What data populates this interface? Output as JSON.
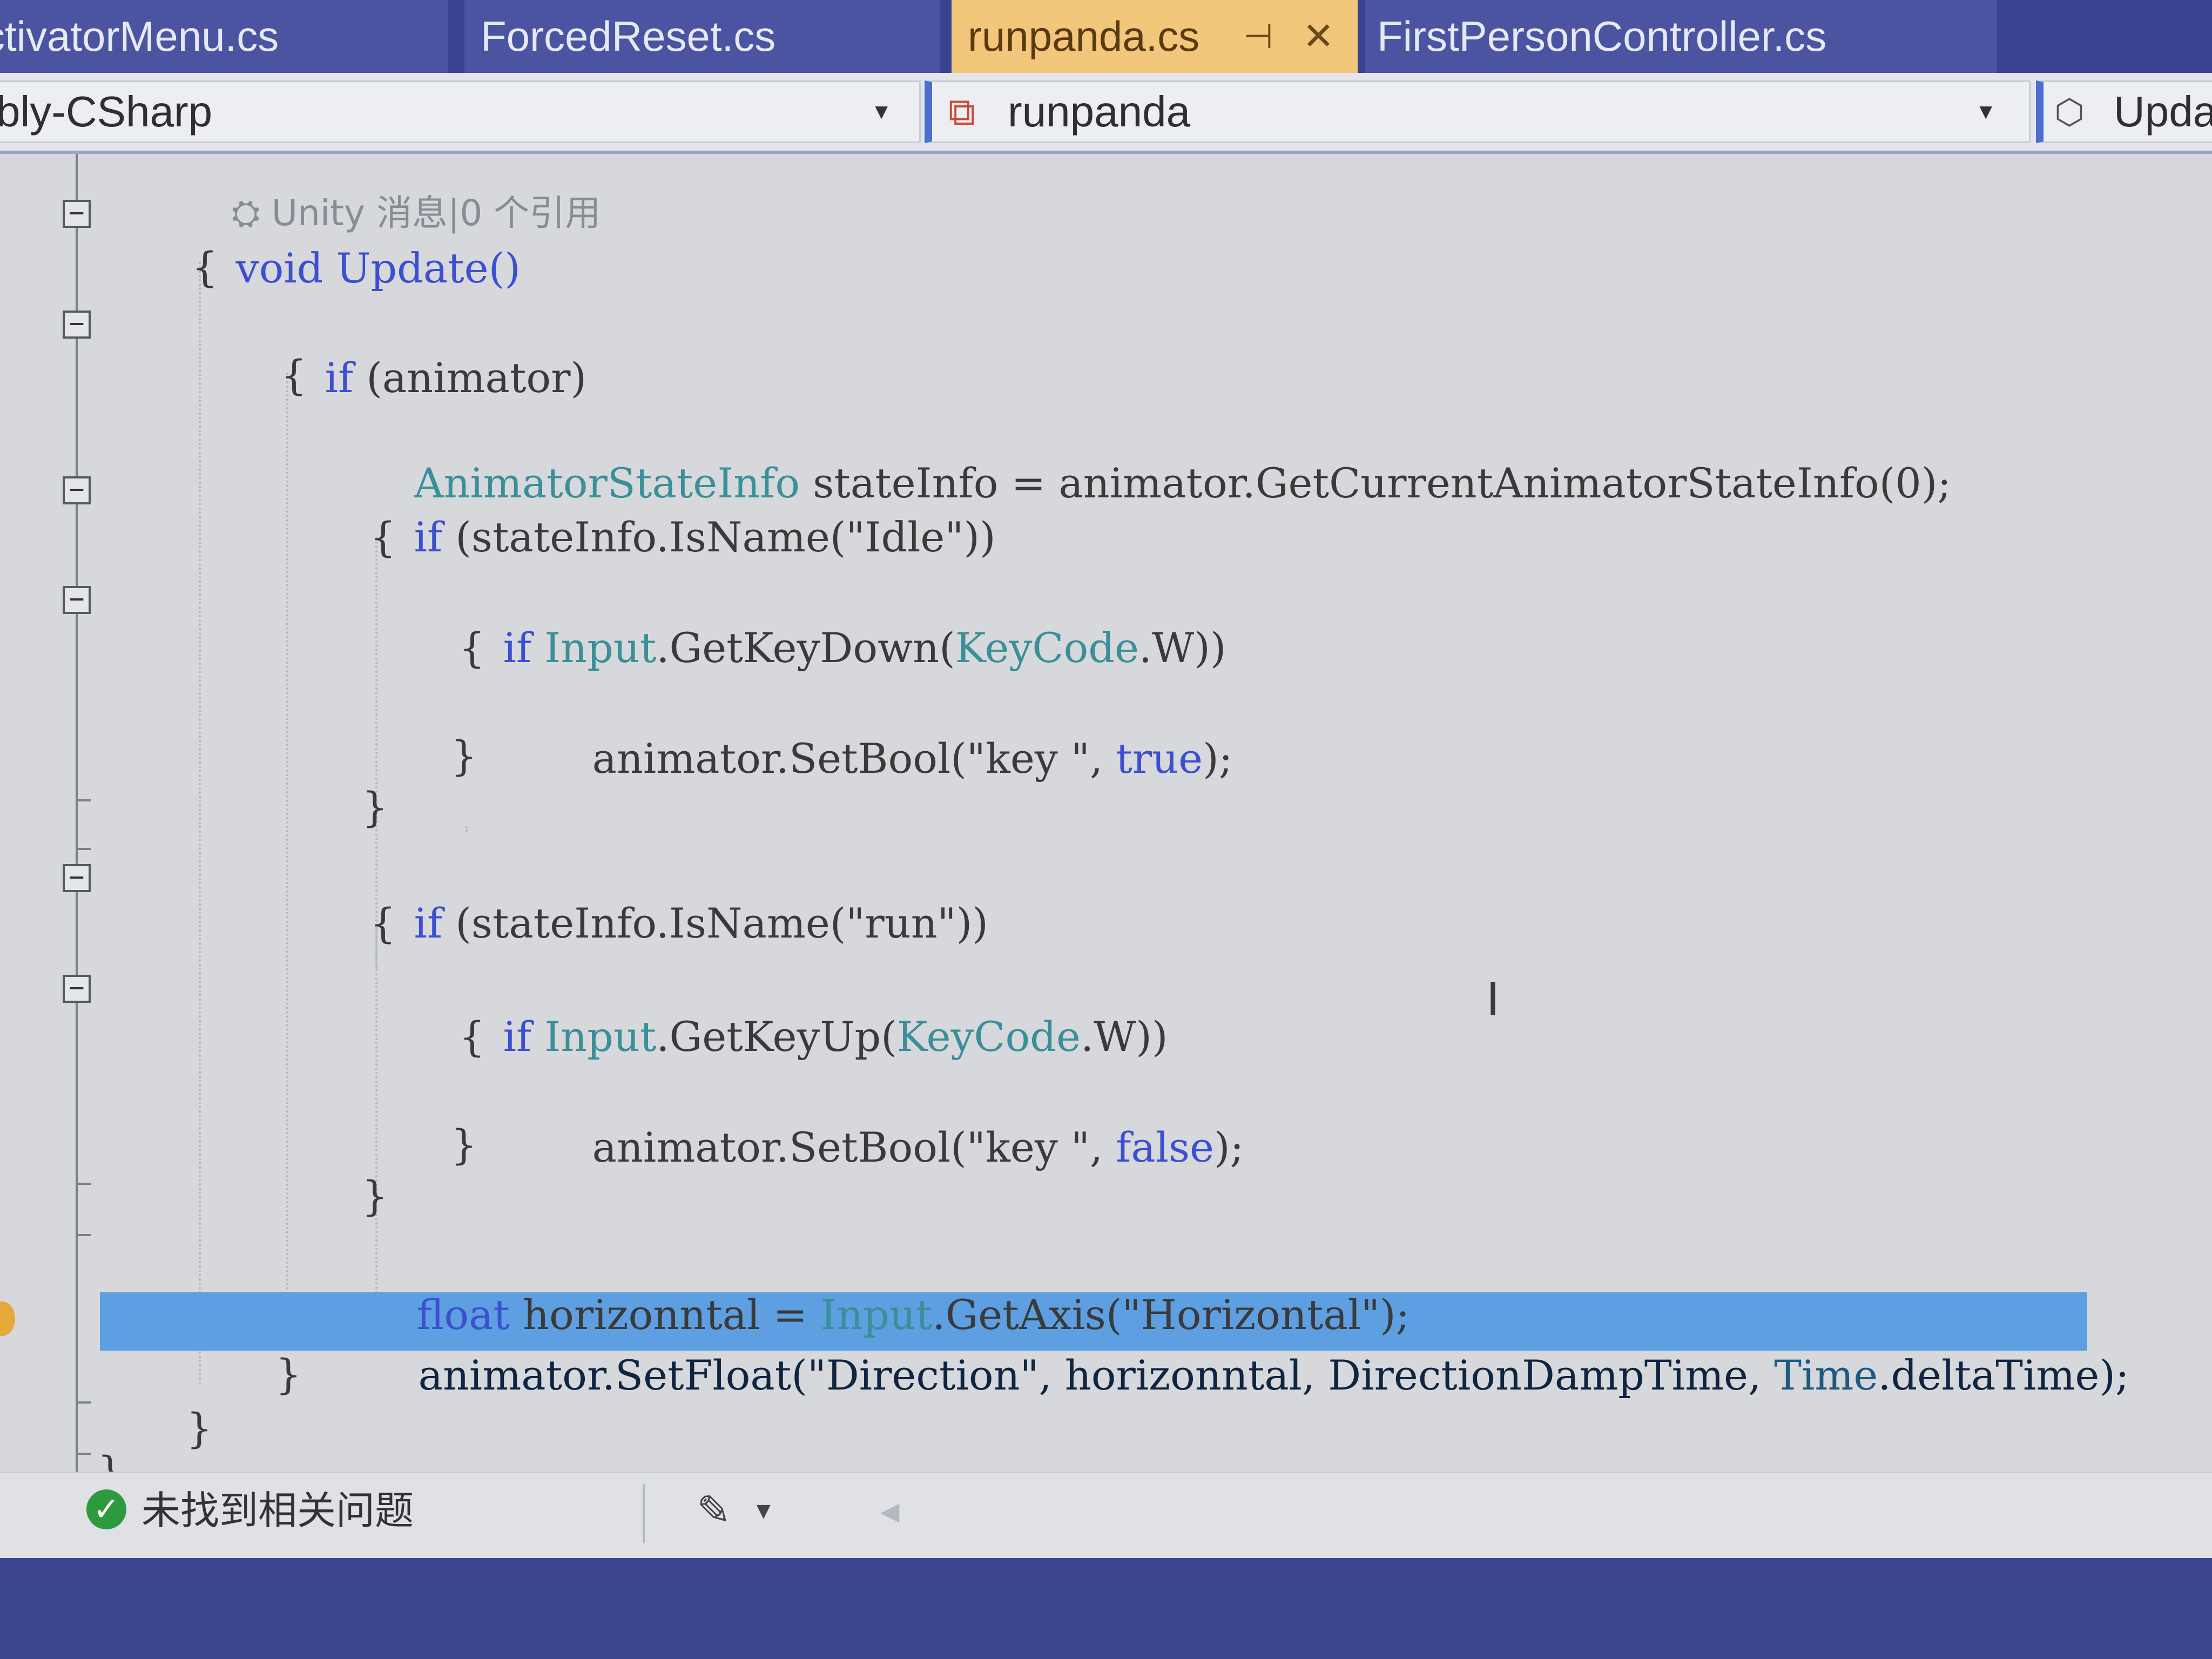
{
  "tabs": [
    {
      "label": "ctivatorMenu.cs"
    },
    {
      "label": "ForcedReset.cs"
    },
    {
      "label": "runpanda.cs",
      "active": true,
      "pin_glyph": "⊣",
      "close_glyph": "✕"
    },
    {
      "label": "FirstPersonController.cs"
    }
  ],
  "nav": {
    "project": "bly-CSharp",
    "class": "runpanda",
    "member": "Upda"
  },
  "code": {
    "codelens": "Unity 消息|0 个引用",
    "lines": {
      "l1_kw": "void",
      "l1_rest": " Update()",
      "l2": "{",
      "l3_kw": "if",
      "l3_rest": " (animator)",
      "l4": "{",
      "l5_type": "AnimatorStateInfo",
      "l5_rest": " stateInfo = animator.GetCurrentAnimatorStateInfo(0);",
      "l6_kw": "if",
      "l6_rest": " (stateInfo.IsName(\"Idle\"))",
      "l7": "{",
      "l8_kw": "if",
      "l8_type1": "Input",
      "l8_mid": ".GetKeyDown(",
      "l8_type2": "KeyCode",
      "l8_rest": ".W))",
      "l9": "{",
      "l10_pre": "animator.SetBool(\"key \", ",
      "l10_kw": "true",
      "l10_post": ");",
      "l11": "}",
      "l12": "}",
      "l13_kw": "if",
      "l13_rest": " (stateInfo.IsName(\"run\"))",
      "l14": "{",
      "l15_kw": "if",
      "l15_type1": "Input",
      "l15_mid": ".GetKeyUp(",
      "l15_type2": "KeyCode",
      "l15_rest": ".W))",
      "l16": "{",
      "l17_pre": "animator.SetBool(\"key \", ",
      "l17_kw": "false",
      "l17_post": ");",
      "l18": "}",
      "l19": "}",
      "l20_kw": "float",
      "l20_mid": " horizonntal = ",
      "l20_type": "Input",
      "l20_rest": ".GetAxis(\"Horizontal\");",
      "l21_pre": "animator.SetFloat(\"Direction\", horizonntal, DirectionDampTime, ",
      "l21_type": "Time",
      "l21_post": ".deltaTime);",
      "l22": "}",
      "l23": "}",
      "l24": "}"
    }
  },
  "status": {
    "message": "未找到相关问题"
  },
  "colors": {
    "tab_active": "#f2c77b",
    "tab_bar": "#39438f",
    "keyword": "#3c4fd0",
    "type": "#3a8f98",
    "selection": "#5d9fe0"
  },
  "icons": {
    "pin": "pin-icon",
    "close": "close-icon",
    "class": "class-icon",
    "member": "member-lock-icon",
    "status_ok": "checkmark-icon",
    "brush": "brush-icon"
  }
}
